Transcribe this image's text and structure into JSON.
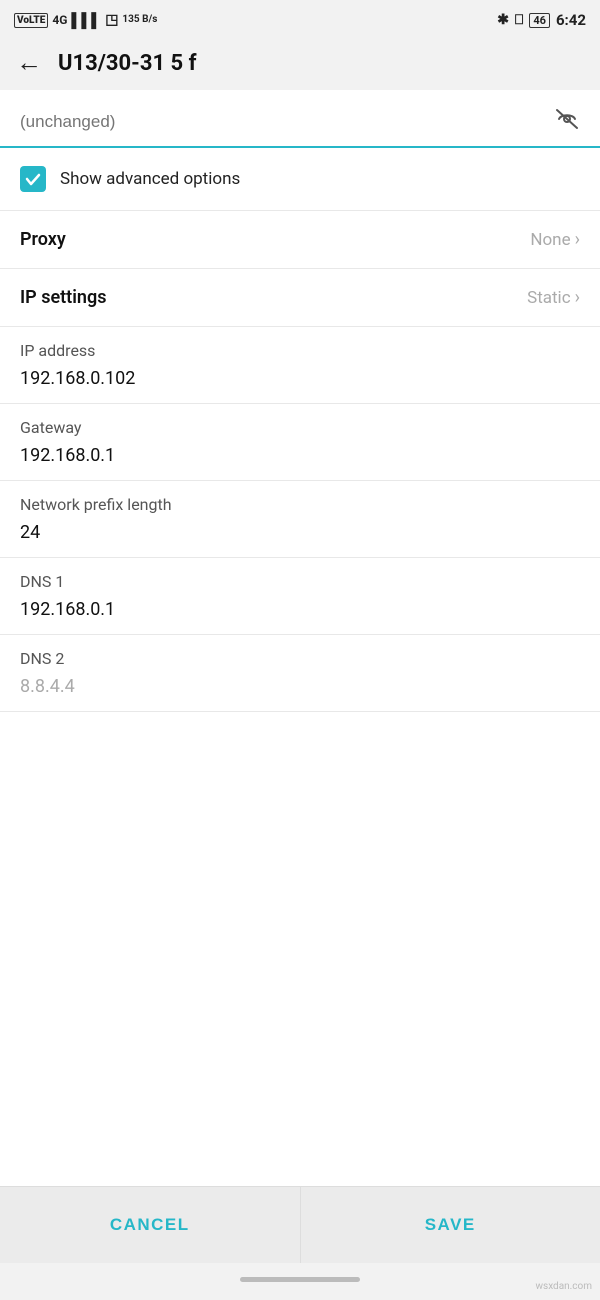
{
  "statusBar": {
    "left": {
      "volte": "VoLTE",
      "signal": "4G",
      "data_speed": "135 B/s"
    },
    "right": {
      "bluetooth": "✱",
      "device": "◫",
      "battery": "46",
      "time": "6:42"
    }
  },
  "header": {
    "title": "U13/30-31 5 f",
    "back_label": "←"
  },
  "password": {
    "placeholder": "(unchanged)",
    "eye_icon": "👁"
  },
  "advanced": {
    "label": "Show advanced options"
  },
  "proxy": {
    "label": "Proxy",
    "value": "None"
  },
  "ip_settings": {
    "label": "IP settings",
    "value": "Static"
  },
  "fields": [
    {
      "sublabel": "IP address",
      "value": "192.168.0.102",
      "muted": false
    },
    {
      "sublabel": "Gateway",
      "value": "192.168.0.1",
      "muted": false
    },
    {
      "sublabel": "Network prefix length",
      "value": "24",
      "muted": false
    },
    {
      "sublabel": "DNS 1",
      "value": "192.168.0.1",
      "muted": false
    },
    {
      "sublabel": "DNS 2",
      "value": "8.8.4.4",
      "muted": true
    }
  ],
  "buttons": {
    "cancel": "CANCEL",
    "save": "SAVE"
  },
  "watermark": "wsxdan.com"
}
